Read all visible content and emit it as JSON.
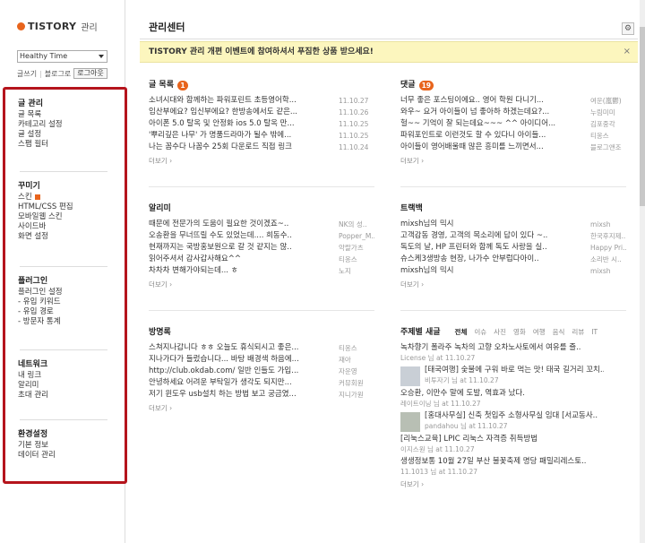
{
  "sidebar": {
    "logo_text": "TISTORY",
    "logo_sub": "관리",
    "blog_select": "Healthy Time",
    "links": {
      "write": "글쓰기",
      "blog": "블로그로",
      "logout": "로그아웃"
    },
    "groups": [
      {
        "title": "글 관리",
        "items": [
          "글 목록",
          "카테고리 설정",
          "글 설정",
          "스팸 필터"
        ]
      },
      {
        "title": "꾸미기",
        "items": [
          "스킨",
          "HTML/CSS 편집",
          "모바일웹 스킨",
          "사이드바",
          "화면 설정"
        ]
      },
      {
        "title": "플러그인",
        "items": [
          "플러그인 설정",
          "- 유입 키워드",
          "- 유입 경로",
          "- 방문자 통계"
        ]
      },
      {
        "title": "네트워크",
        "items": [
          "내 링크",
          "알리미",
          "초대 관리"
        ]
      },
      {
        "title": "환경설정",
        "items": [
          "기본 정보",
          "데이터 관리"
        ]
      }
    ]
  },
  "main": {
    "title": "관리센터",
    "notice": "TISTORY 관리 개편 이벤트에 참여하셔서 푸짐한 상품 받으세요!",
    "notice_close": "×",
    "more_label": "더보기 ›",
    "posts": {
      "title": "글 목록",
      "count": "1",
      "rows": [
        {
          "text": "소녀시대와 함께하는 파워포린트 초등영어학...",
          "meta": "11.10.27"
        },
        {
          "text": "임산부에요? 임신부에요? 한방송에서도 같은...",
          "meta": "11.10.26"
        },
        {
          "text": "아이폰 5.0 탈옥 및 안정화 ios 5.0 탈옥 만...",
          "meta": "11.10.25"
        },
        {
          "text": "'뿌리깊은 나무' 가 명품드라마가 될수 밖에...",
          "meta": "11.10.25"
        },
        {
          "text": "나는 꼼수다 나꼼수 25회 다운로드 직접 링크",
          "meta": "11.10.24"
        }
      ]
    },
    "comments": {
      "title": "댓글",
      "count": "19",
      "rows": [
        {
          "text": "너무 좋은 포스팅이에요.. 영어 학원 다니기...",
          "meta": "여운(嵐鬱)"
        },
        {
          "text": "와우~ 요거 아이들이 넘 좋아하 하겠는데요?...",
          "meta": "누림미미"
        },
        {
          "text": "헐~~ 기억이 잘 되는데요~~~ ^^ 아이디어...",
          "meta": "김포중각"
        },
        {
          "text": "파워포인트로 이런것도 할 수 있다니 아이들...",
          "meta": "티옹스"
        },
        {
          "text": "아이들이 영어배울때 많은 흥미를 느끼면서...",
          "meta": "블로그앤조"
        }
      ]
    },
    "notifications": {
      "title": "알리미",
      "rows": [
        {
          "text": "때문에 전문가의 도움이 필요한 것이겠죠~..",
          "meta": "NK의 성.."
        },
        {
          "text": "오송환을 무너뜨릴 수도 있었는데.... 희동수..",
          "meta": "Popper_M.."
        },
        {
          "text": "현재까지는 국방홍보원으로 갈 것 같지는 않..",
          "meta": "악랄가츠"
        },
        {
          "text": "읽어주셔서 감사갑사해요^^",
          "meta": "티옹스"
        },
        {
          "text": "차차차 변해가야되는데... ㅎ",
          "meta": "노지"
        }
      ]
    },
    "trackbacks": {
      "title": "트랙백",
      "rows": [
        {
          "text": "mixsh님의 믹시",
          "meta": "mixsh"
        },
        {
          "text": "고객감동 경영, 고객의 목소리에 답이 있다 ~..",
          "meta": "한국후지제.."
        },
        {
          "text": "독도의 날, HP 프린터와 함께 독도 사랑을 실..",
          "meta": "Happy Pri.."
        },
        {
          "text": "슈스케3생방송 현장, 나가수 안부럽다아이..",
          "meta": "소리반 시.."
        },
        {
          "text": "mixsh님의 믹시",
          "meta": "mixsh"
        }
      ]
    },
    "guestbook": {
      "title": "방명록",
      "rows": [
        {
          "text": "스쳐지나갑니다 ㅎㅎ 오늘도 휴식되시고 좋은...",
          "meta": "티옹스"
        },
        {
          "text": "지나가다가 들렀습니다... 바탕 배경색 하음에...",
          "meta": "재아"
        },
        {
          "text": "http://club.okdab.com/ 일반 인들도 가입...",
          "meta": "자운영"
        },
        {
          "text": "안녕하세요 어려운 부탁일가 생각도 되지만...",
          "meta": "커뮤회원"
        },
        {
          "text": "저기 윈도우 usb설치 하는 방법 보고 궁금였...",
          "meta": "지니가원"
        }
      ]
    },
    "topics": {
      "title": "주제별 새글",
      "tabs": [
        "전체",
        "이슈",
        "사진",
        "영화",
        "여행",
        "음식",
        "리뷰",
        "IT"
      ],
      "items": [
        {
          "text": "녹차향기 폴라주 녹차의 고향 오차노사토에서 여유를 즐..",
          "meta": "License 님 at 11.10.27",
          "thumb": false
        },
        {
          "text": "[태국여행] 숯불에 구워 바로 먹는 맛! 태국 길거리 꼬치..",
          "meta": "비투자기 님 at 11.10.27",
          "thumb": true
        },
        {
          "text": "오승환, 이만수 말에 도발, 역효과 났다.",
          "meta": "레이트이닝 님 at 11.10.27",
          "thumb": false
        },
        {
          "text": "[홍대사무실] 신축 첫입주 소형사무실 임대 [서교동사..",
          "meta": "pandahou 님 at 11.10.27",
          "thumb": true
        },
        {
          "text": "[리눅스교육] LPIC 리눅스 자격증 취득방법",
          "meta": "이지스원 님 at 11.10.27",
          "thumb": false
        },
        {
          "text": "생생정보통 10월 27일 부산 불꽃축제 명당 패밀리레스토..",
          "meta": "11.1013 님 at 11.10.27",
          "thumb": false
        }
      ]
    }
  }
}
